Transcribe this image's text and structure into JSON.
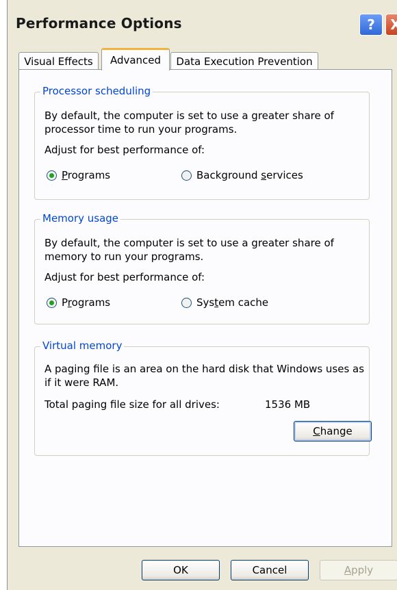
{
  "window": {
    "title": "Performance Options",
    "help_label": "?",
    "close_label": "X"
  },
  "tabs": [
    {
      "label": "Visual Effects"
    },
    {
      "label": "Advanced"
    },
    {
      "label": "Data Execution Prevention"
    }
  ],
  "processor": {
    "legend": "Processor scheduling",
    "description": "By default, the computer is set to use a greater share of processor time to run your programs.",
    "adjust_label": "Adjust for best performance of:",
    "options": [
      {
        "label_pre": "",
        "label_u": "P",
        "label_post": "rograms",
        "checked": true
      },
      {
        "label_pre": "Background ",
        "label_u": "s",
        "label_post": "ervices",
        "checked": false
      }
    ]
  },
  "memory": {
    "legend": "Memory usage",
    "description": "By default, the computer is set to use a greater share of memory to run your programs.",
    "adjust_label": "Adjust for best performance of:",
    "options": [
      {
        "label_pre": "P",
        "label_u": "r",
        "label_post": "ograms",
        "checked": true
      },
      {
        "label_pre": "Sys",
        "label_u": "t",
        "label_post": "em cache",
        "checked": false
      }
    ]
  },
  "virtual": {
    "legend": "Virtual memory",
    "description": "A paging file is an area on the hard disk that Windows uses as if it were RAM.",
    "total_label": "Total paging file size for all drives:",
    "total_value": "1536 MB",
    "change_label_u": "C",
    "change_label_post": "hange"
  },
  "footer": {
    "ok_label": "OK",
    "cancel_label": "Cancel",
    "apply_label_u": "A",
    "apply_label_post": "pply"
  }
}
